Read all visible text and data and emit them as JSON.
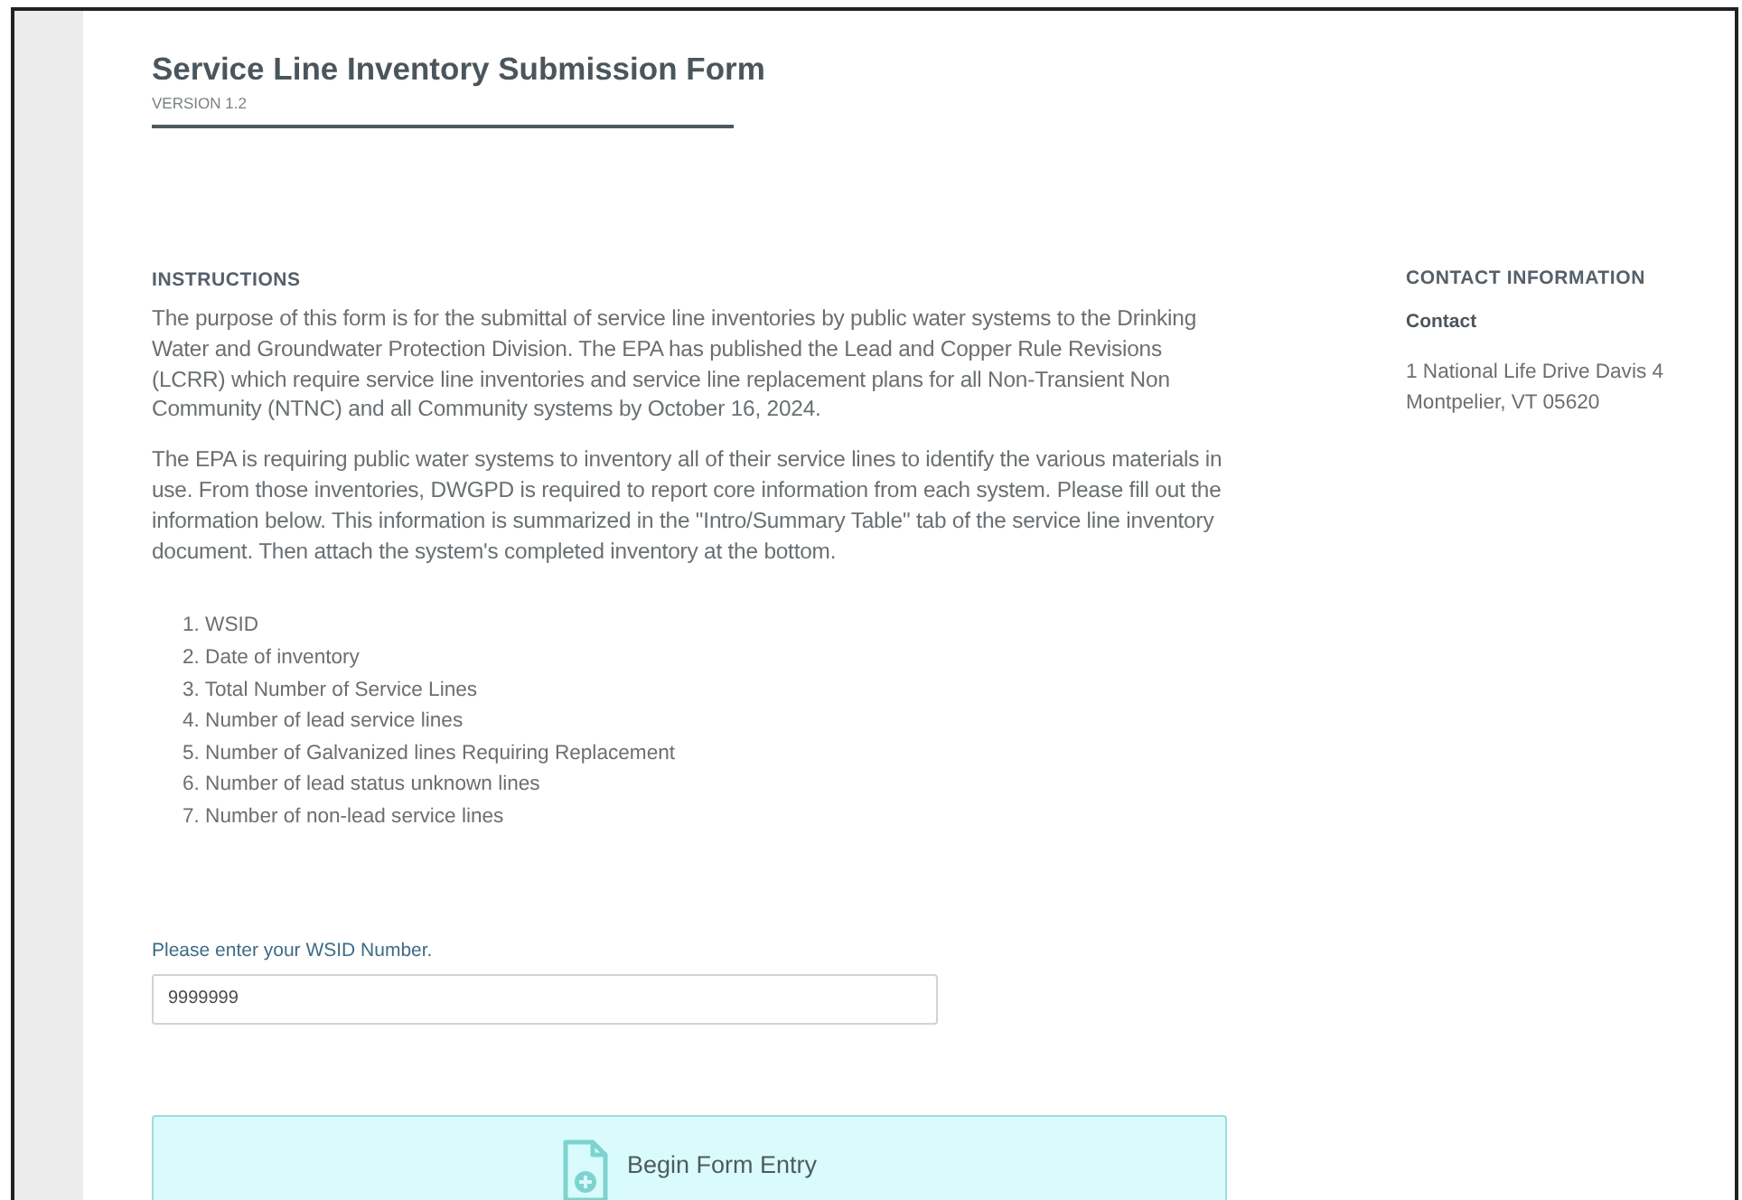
{
  "form": {
    "title": "Service Line Inventory Submission Form",
    "version": "VERSION 1.2"
  },
  "instructions": {
    "heading": "INSTRUCTIONS",
    "paragraphs": [
      "The purpose of this form is for the submittal of service line inventories by public water systems to the Drinking Water and Groundwater Protection Division. The EPA has published the Lead and Copper Rule Revisions (LCRR) which require service line inventories and service line replacement plans for all Non-Transient Non Community (NTNC) and all Community systems by October 16, 2024.",
      "The EPA is requiring public water systems to inventory all of their service lines to identify the various materials in use. From those inventories, DWGPD is required to report core information from each system. Please fill out the information below. This information is summarized in the \"Intro/Summary Table\" tab of the service line inventory document. Then attach the system's completed inventory at the bottom."
    ],
    "list": [
      "1. WSID",
      "2. Date of inventory",
      "3. Total Number of Service Lines",
      "4. Number of lead service lines",
      "5. Number of Galvanized lines Requiring Replacement",
      "6. Number of lead status unknown lines",
      "7. Number of non-lead service lines"
    ]
  },
  "wsid_field": {
    "label": "Please enter your WSID Number.",
    "value": "9999999"
  },
  "begin_button": {
    "label": "Begin Form Entry"
  },
  "contact": {
    "heading": "CONTACT INFORMATION",
    "name": "Contact",
    "address": [
      "1 National Life Drive Davis 4",
      "Montpelier, VT 05620"
    ]
  }
}
